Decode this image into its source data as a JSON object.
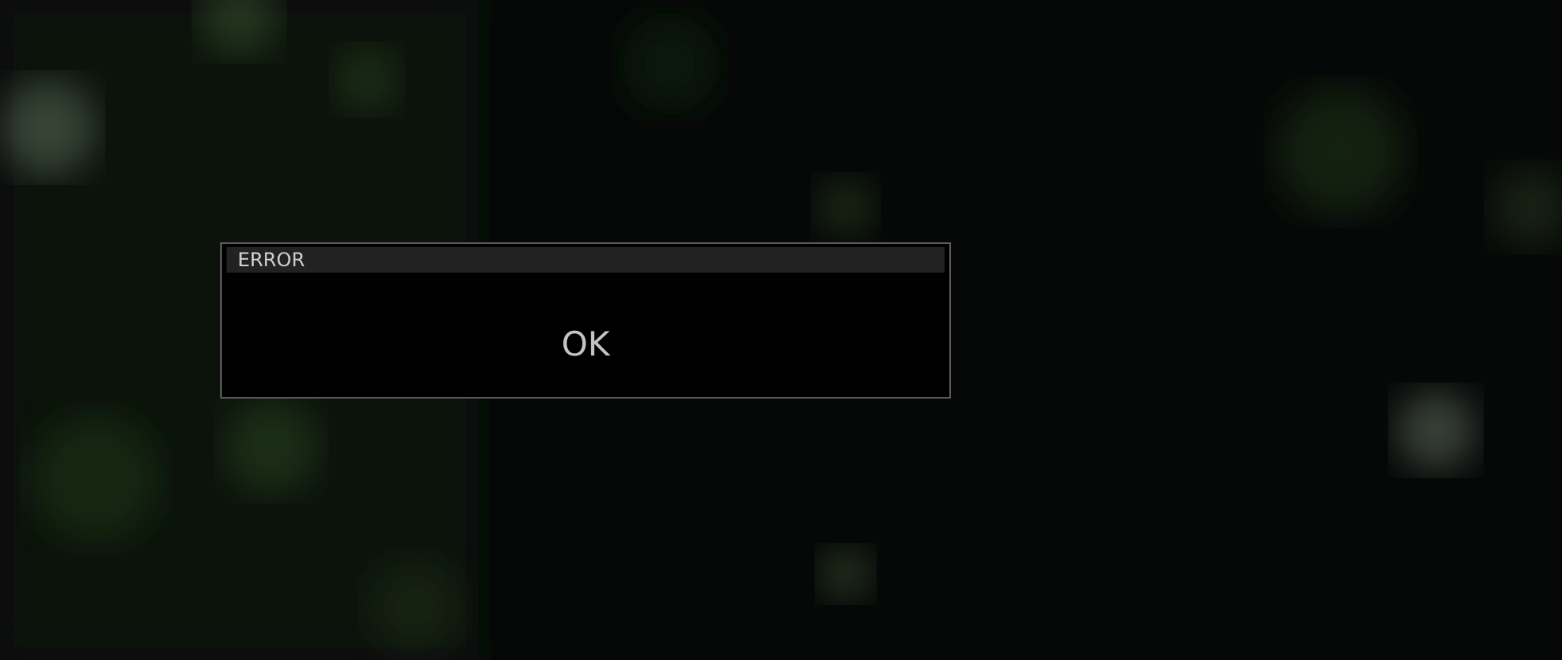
{
  "dialog": {
    "title": "ERROR",
    "buttons": [
      "OK"
    ]
  }
}
